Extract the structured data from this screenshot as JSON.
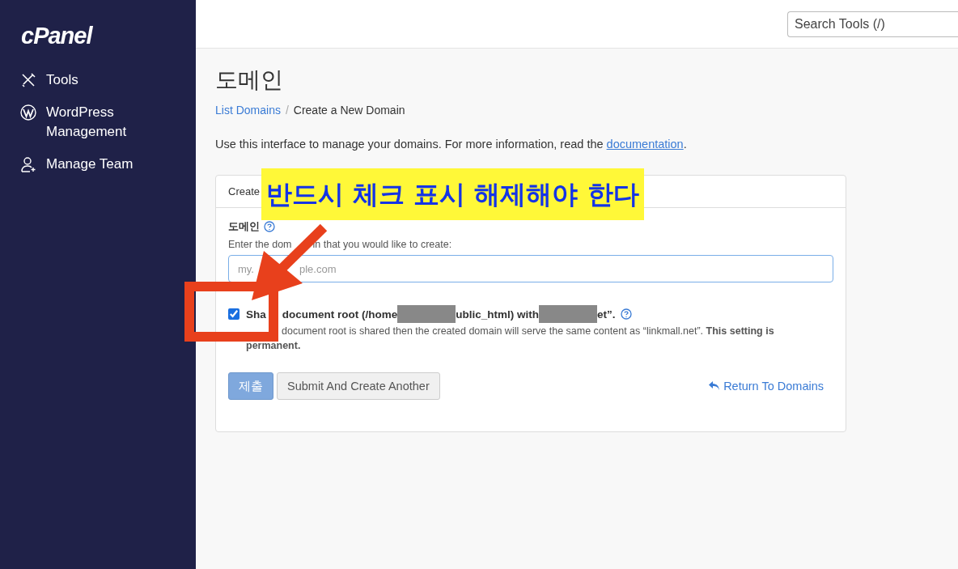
{
  "sidebar": {
    "logo": "cPanel",
    "items": [
      {
        "label": "Tools",
        "kind": "tools"
      },
      {
        "label": "WordPress Management",
        "kind": "wordpress"
      },
      {
        "label": "Manage Team",
        "kind": "team"
      }
    ]
  },
  "search": {
    "placeholder": "Search Tools (/)"
  },
  "page_title": "도메인",
  "breadcrumb": {
    "separator": "/",
    "items": [
      {
        "label": "List Domains",
        "link": true
      },
      {
        "label": "Create a New Domain",
        "link": false
      }
    ]
  },
  "intro": {
    "text": "Use this interface to manage your domains. For more information, read the",
    "link": "documentation",
    "end": "."
  },
  "panel": {
    "header": "Create",
    "field_label": "도메인",
    "field_hint": [
      "Enter the dom",
      "in that you would like to create:"
    ],
    "placeholder": [
      "my.",
      "ple.com"
    ],
    "share": {
      "checked": true,
      "parts": [
        "Sha",
        "document root (/home",
        "ublic_html) with",
        "et”."
      ],
      "help": [
        "document root is shared then the created domain will serve the same content as “linkmall.net”. **This setting is**",
        "**permanent.**"
      ]
    },
    "submit": "제출",
    "submit_another": "Submit And Create Another",
    "return": "Return To Domains"
  },
  "annotation": {
    "callout": "반드시 체크 표시 해제해야 한다"
  }
}
